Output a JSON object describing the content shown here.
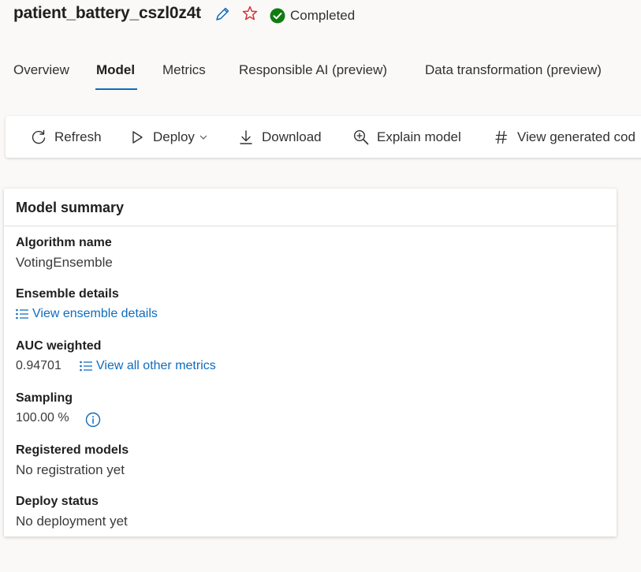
{
  "header": {
    "run_name": "patient_battery_cszl0z4t",
    "status": "Completed",
    "colors": {
      "accent": "#0f6cbd",
      "success": "#107c10",
      "favorite": "#d13438"
    }
  },
  "tabs": [
    {
      "label": "Overview"
    },
    {
      "label": "Model",
      "active": true
    },
    {
      "label": "Metrics"
    },
    {
      "label": "Responsible AI (preview)"
    },
    {
      "label": "Data transformation (preview)"
    }
  ],
  "toolbar": {
    "refresh": {
      "label": "Refresh",
      "icon": "refresh-icon"
    },
    "deploy": {
      "label": "Deploy",
      "icon": "play-icon"
    },
    "download": {
      "label": "Download",
      "icon": "download-icon"
    },
    "explain": {
      "label": "Explain model",
      "icon": "zoom-in-icon"
    },
    "view_code": {
      "label": "View generated cod",
      "icon": "hash-icon"
    }
  },
  "summary": {
    "title": "Model summary",
    "algorithm": {
      "label": "Algorithm name",
      "value": "VotingEnsemble"
    },
    "ensemble": {
      "label": "Ensemble details",
      "link": "View ensemble details"
    },
    "auc": {
      "label": "AUC weighted",
      "value": "0.94701",
      "link": "View all other metrics"
    },
    "sampling": {
      "label": "Sampling",
      "value": "100.00 %"
    },
    "registered": {
      "label": "Registered models",
      "value": "No registration yet"
    },
    "deploy_status": {
      "label": "Deploy status",
      "value": "No deployment yet"
    }
  }
}
